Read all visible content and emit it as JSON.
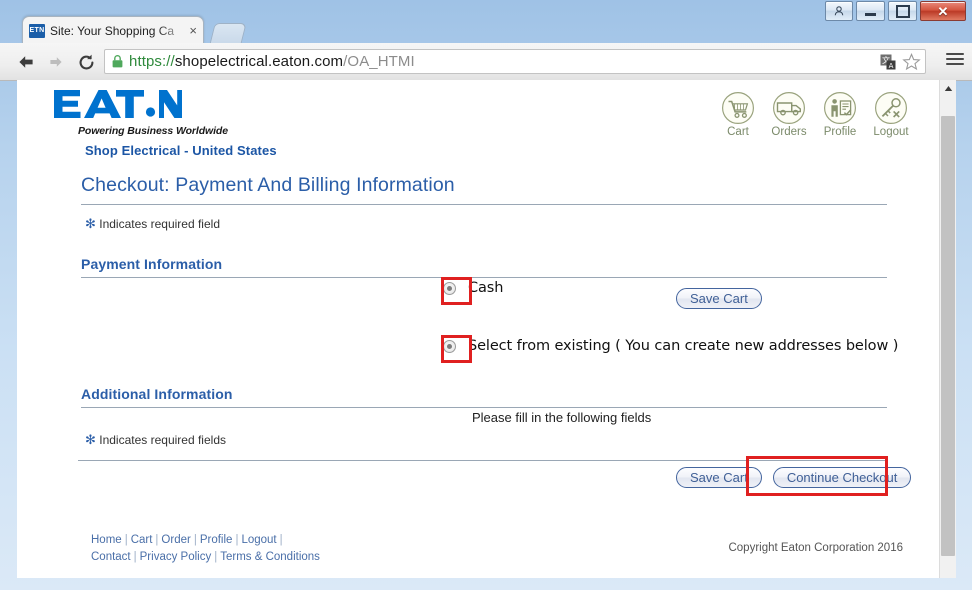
{
  "browser": {
    "tab": {
      "title": "Site:  Your Shopping Ca",
      "favicon_text": "ETN",
      "close_label": "×"
    },
    "url": {
      "scheme": "https://",
      "host": "shopelectrical.eaton.com",
      "path": "/OA_HTMI",
      "security_icon": "lock-icon"
    },
    "nav": {
      "back": "back-arrow-icon",
      "forward": "forward-arrow-icon",
      "reload": "reload-icon"
    },
    "actions": {
      "translate": "translate-icon",
      "bookmark": "star-icon",
      "menu": "hamburger-menu-icon"
    },
    "window_controls": {
      "person": "person-icon",
      "minimize": "minimize-icon",
      "maximize": "maximize-icon",
      "close": "close-icon"
    }
  },
  "site": {
    "logo_text": "EAT·N",
    "tagline": "Powering Business Worldwide",
    "name": "Shop Electrical - United States",
    "nav_items": [
      {
        "label": "Cart",
        "icon": "shopping-cart-icon"
      },
      {
        "label": "Orders",
        "icon": "truck-icon"
      },
      {
        "label": "Profile",
        "icon": "person-form-icon"
      },
      {
        "label": "Logout",
        "icon": "key-icon"
      }
    ]
  },
  "page": {
    "title": "Checkout: Payment And Billing Information",
    "required_note_top": "Indicates required field",
    "required_note_bottom": "Indicates required fields",
    "asterisk": "✻",
    "save_cart_top": "Save Cart",
    "sections": {
      "payment": {
        "heading": "Payment Information",
        "options": [
          {
            "label": "Cash",
            "selected": true,
            "annotated": true
          },
          {
            "label": "Select from existing ( You can create new addresses below )",
            "selected": true,
            "annotated": true
          }
        ]
      },
      "additional": {
        "heading": "Additional Information",
        "instruction": "Please fill in the following fields"
      }
    },
    "buttons": {
      "save_cart": "Save Cart",
      "continue_checkout": "Continue Checkout"
    },
    "footer": {
      "row1": [
        "Home",
        "Cart",
        "Order",
        "Profile",
        "Logout"
      ],
      "row2": [
        "Contact",
        "Privacy Policy",
        "Terms & Conditions"
      ],
      "copyright": "Copyright Eaton Corporation 2016"
    }
  },
  "colors": {
    "eaton_blue": "#0072ce",
    "heading_blue": "#2b5ea8",
    "annotation_red": "#e02020",
    "nav_icon": "#8a9470"
  }
}
